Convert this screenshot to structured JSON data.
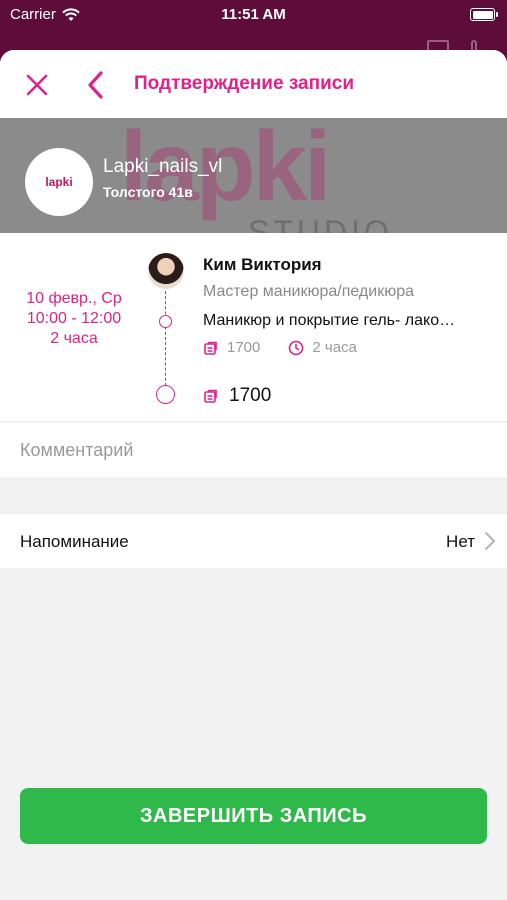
{
  "status_bar": {
    "carrier": "Carrier",
    "time": "11:51 AM"
  },
  "header": {
    "title": "Подтверждение записи"
  },
  "salon": {
    "logo_text": "lapki",
    "name": "Lapki_nails_vl",
    "address": "Толстого 41в",
    "banner_brand": "lapki",
    "banner_sub": "STUDIO"
  },
  "booking": {
    "date": "10 февр., Ср",
    "time_range": "10:00 - 12:00",
    "duration": "2 часа",
    "master_name": "Ким Виктория",
    "master_role": "Мастер маникюра/педикюра",
    "service_name": "Маникюр и покрытие гель- лако…",
    "service_price": "1700",
    "service_duration": "2 часа",
    "total": "1700"
  },
  "comment": {
    "placeholder": "Комментарий",
    "value": ""
  },
  "reminder": {
    "label": "Напоминание",
    "value": "Нет"
  },
  "actions": {
    "submit_label": "ЗАВЕРШИТЬ ЗАПИСЬ"
  },
  "colors": {
    "accent": "#e0218a",
    "submit": "#2eb94a",
    "background_app": "#5e0d3a"
  },
  "icons": {
    "close": "close-icon",
    "back": "chevron-left-icon",
    "price": "price-tag-icon",
    "clock": "clock-icon",
    "chevron": "chevron-right-icon",
    "wifi": "wifi-icon",
    "battery": "battery-icon"
  }
}
